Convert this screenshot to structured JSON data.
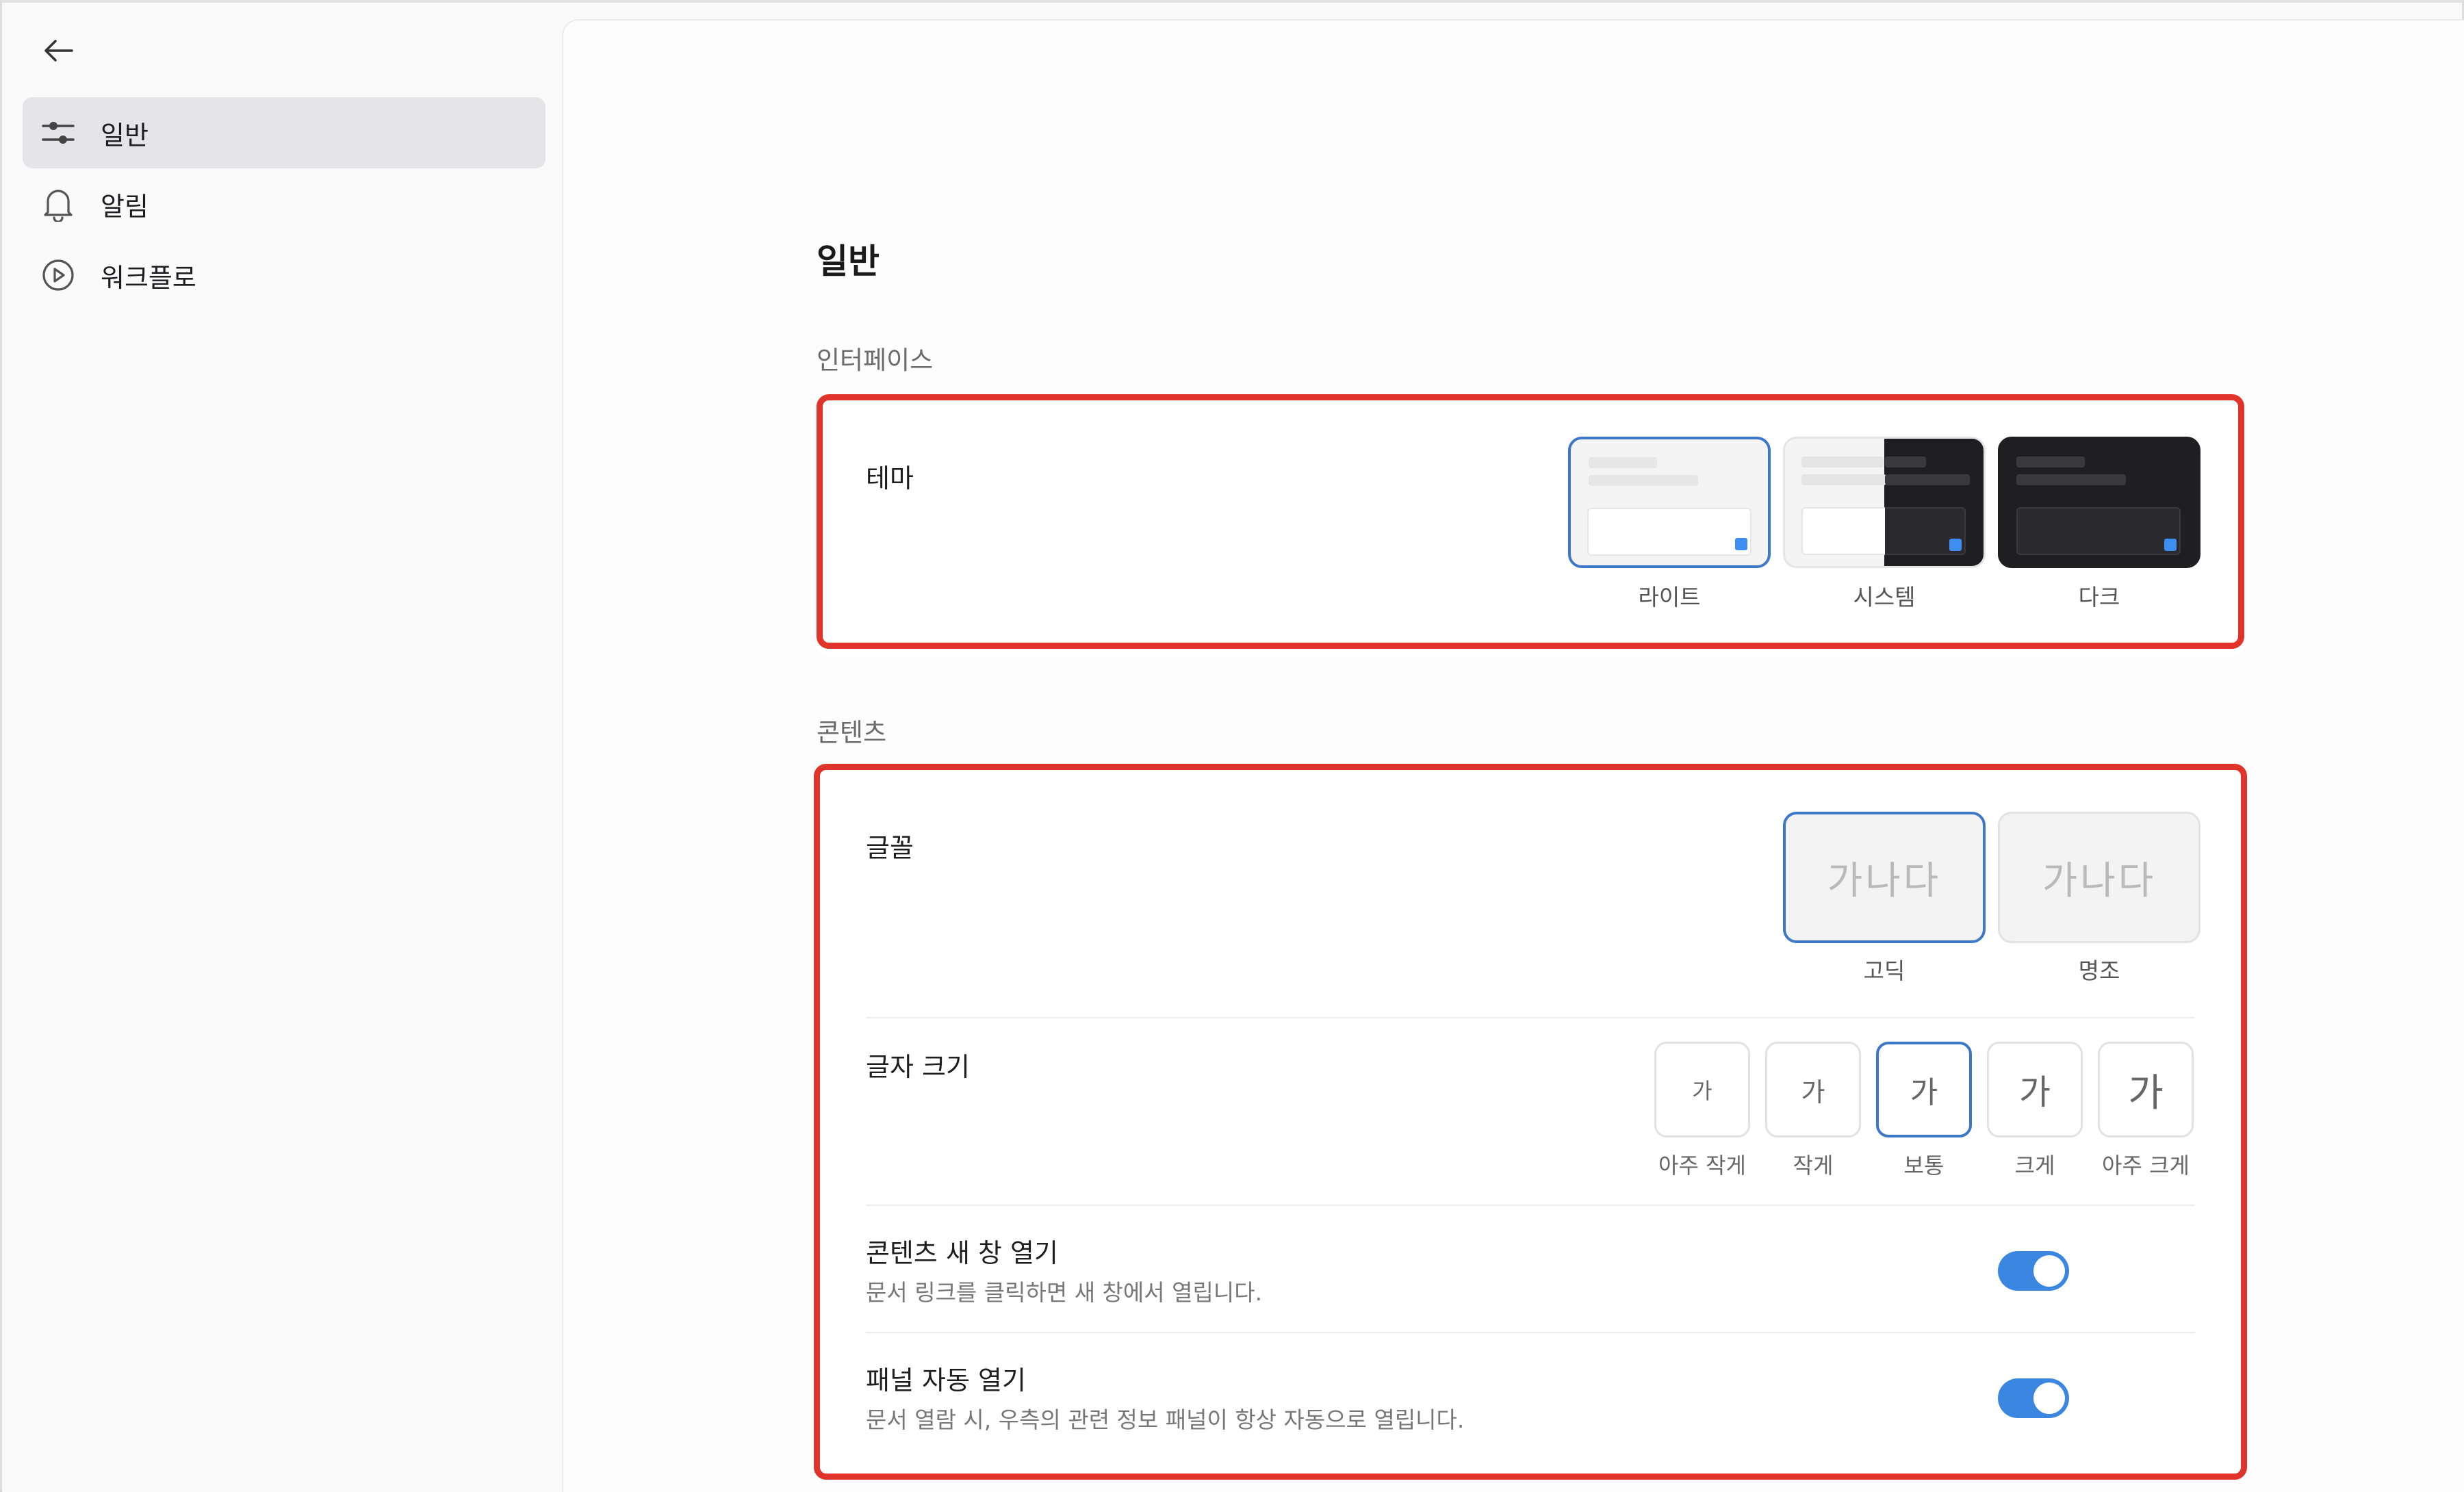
{
  "sidebar": {
    "back_icon": "arrow-left-icon",
    "items": [
      {
        "label": "일반",
        "icon": "sliders-icon",
        "active": true
      },
      {
        "label": "알림",
        "icon": "bell-icon",
        "active": false
      },
      {
        "label": "워크플로",
        "icon": "play-circle-icon",
        "active": false
      }
    ]
  },
  "main": {
    "title": "일반",
    "interface_section": {
      "label": "인터페이스",
      "theme": {
        "label": "테마",
        "options": [
          "라이트",
          "시스템",
          "다크"
        ],
        "selected": "라이트"
      }
    },
    "content_section": {
      "label": "콘텐츠",
      "font": {
        "label": "글꼴",
        "sample": "가나다",
        "options": [
          "고딕",
          "명조"
        ],
        "selected": "고딕"
      },
      "font_size": {
        "label": "글자 크기",
        "sample": "가",
        "options": [
          "아주 작게",
          "작게",
          "보통",
          "크게",
          "아주 크게"
        ],
        "selected": "보통"
      },
      "open_new_window": {
        "title": "콘텐츠 새 창 열기",
        "description": "문서 링크를 클릭하면 새 창에서 열립니다.",
        "enabled": true
      },
      "auto_panel": {
        "title": "패널 자동 열기",
        "description": "문서 열람 시, 우측의 관련 정보 패널이 항상 자동으로 열립니다.",
        "enabled": true
      }
    }
  },
  "colors": {
    "accent": "#3b86e0",
    "selection_border": "#3d78c8",
    "highlight_box": "#e0342a"
  }
}
